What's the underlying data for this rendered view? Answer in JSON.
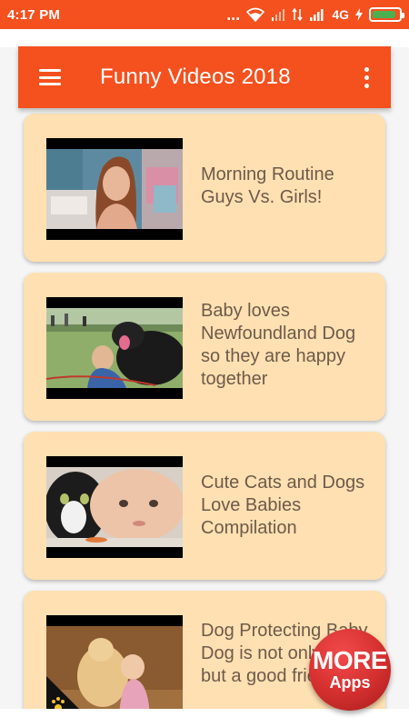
{
  "status_bar": {
    "time": "4:17 PM",
    "dots": "...",
    "network": "4G",
    "battery_fraction": 0.9
  },
  "app_bar": {
    "title": "Funny Videos 2018"
  },
  "videos": [
    {
      "title": "Morning Routine Guys Vs. Girls!"
    },
    {
      "title": "Baby loves Newfoundland Dog so they are happy together"
    },
    {
      "title": "Cute Cats and Dogs Love Babies Compilation"
    },
    {
      "title": "Dog Protecting Baby Dog is not only a pet but a good friend"
    }
  ],
  "more_apps": {
    "line1": "MORE",
    "line2": "Apps"
  },
  "colors": {
    "primary": "#f4511e",
    "card": "#ffe0b2",
    "title_text": "#6d5a4a",
    "badge": "#d32f2f"
  }
}
